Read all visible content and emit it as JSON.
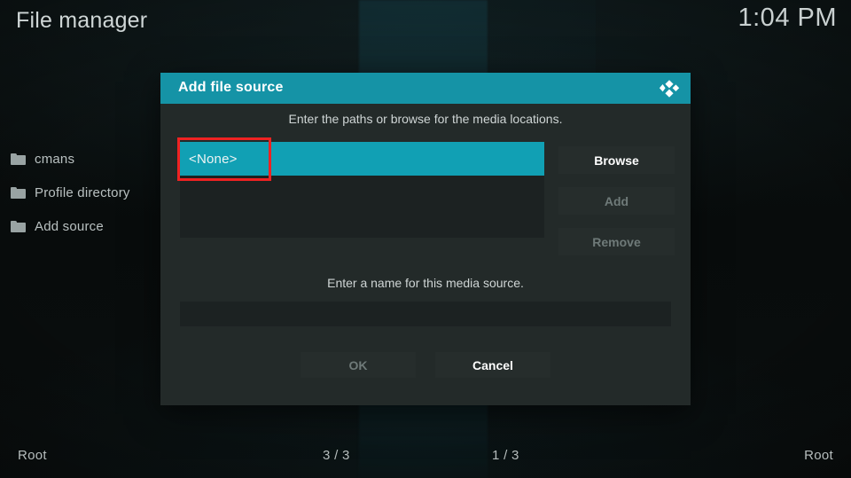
{
  "window": {
    "app_title": "File manager",
    "clock": "1:04 PM"
  },
  "file_panel": {
    "items": [
      {
        "icon": "folder-icon",
        "label": "cmans"
      },
      {
        "icon": "folder-icon",
        "label": "Profile directory"
      },
      {
        "icon": "folder-icon",
        "label": "Add source"
      }
    ]
  },
  "dialog": {
    "title": "Add file source",
    "logo_icon": "kodi-logo-icon",
    "paths_hint": "Enter the paths or browse for the media locations.",
    "paths": [
      {
        "label": "<None>",
        "selected": true
      }
    ],
    "side_buttons": [
      {
        "label": "Browse",
        "enabled": true
      },
      {
        "label": "Add",
        "enabled": false
      },
      {
        "label": "Remove",
        "enabled": false
      }
    ],
    "name_hint": "Enter a name for this media source.",
    "name_value": "",
    "name_placeholder": "",
    "bottom_buttons": [
      {
        "label": "OK",
        "enabled": false
      },
      {
        "label": "Cancel",
        "enabled": true
      }
    ]
  },
  "footer": {
    "left": "Root",
    "left_count": "3 / 3",
    "right_count": "1 / 3",
    "right": "Root"
  },
  "colors": {
    "header_teal": "#1593a6",
    "selection_teal": "#11a0b4",
    "dialog_bg": "#232a29",
    "panel_bg": "#1c2222",
    "annotation_red": "#ee2222"
  }
}
